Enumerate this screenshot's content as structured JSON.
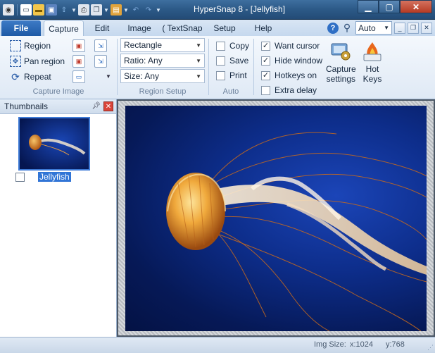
{
  "window": {
    "title": "HyperSnap 8 - [Jellyfish]",
    "minimize": "▁",
    "maximize": "▢",
    "close": "✕"
  },
  "qat": {
    "icons": [
      "camera-icon",
      "new-icon",
      "open-icon",
      "save-icon",
      "upload-icon",
      "print-icon",
      "copy-window-icon",
      "paste-icon",
      "undo-icon",
      "redo-icon"
    ]
  },
  "tabs": {
    "file": "File",
    "items": [
      "Capture",
      "Edit",
      "Image",
      "( TextSnap",
      "Setup",
      "Help"
    ],
    "active": "Capture"
  },
  "toolbar_right": {
    "help": "?",
    "zoom": "Auto"
  },
  "ribbon": {
    "capture_image": {
      "label": "Capture Image",
      "region": "Region",
      "pan_region": "Pan region",
      "repeat": "Repeat"
    },
    "region_setup": {
      "label": "Region Setup",
      "shape": "Rectangle",
      "ratio": "Ratio: Any",
      "size": "Size: Any"
    },
    "auto": {
      "label": "Auto",
      "copy": "Copy",
      "save": "Save",
      "print": "Print"
    },
    "options": {
      "want_cursor": "Want cursor",
      "hide_window": "Hide window",
      "hotkeys_on": "Hotkeys on",
      "extra_delay": "Extra delay",
      "checked": {
        "want_cursor": true,
        "hide_window": true,
        "hotkeys_on": true,
        "extra_delay": false
      },
      "capture_settings": "Capture settings",
      "capture_settings_line1": "Capture",
      "capture_settings_line2": "settings",
      "hot_keys_line1": "Hot",
      "hot_keys_line2": "Keys"
    }
  },
  "thumbnails": {
    "title": "Thumbnails",
    "items": [
      {
        "label": "Jellyfish",
        "checked": false
      }
    ]
  },
  "status": {
    "img_size_label": "Img Size:",
    "x": "x:1024",
    "y": "y:768"
  },
  "colors": {
    "titlebar": "#2c5987",
    "file_tab": "#1e5aa6",
    "selection": "#3175d6",
    "image_bg": "#0d2d8a"
  }
}
